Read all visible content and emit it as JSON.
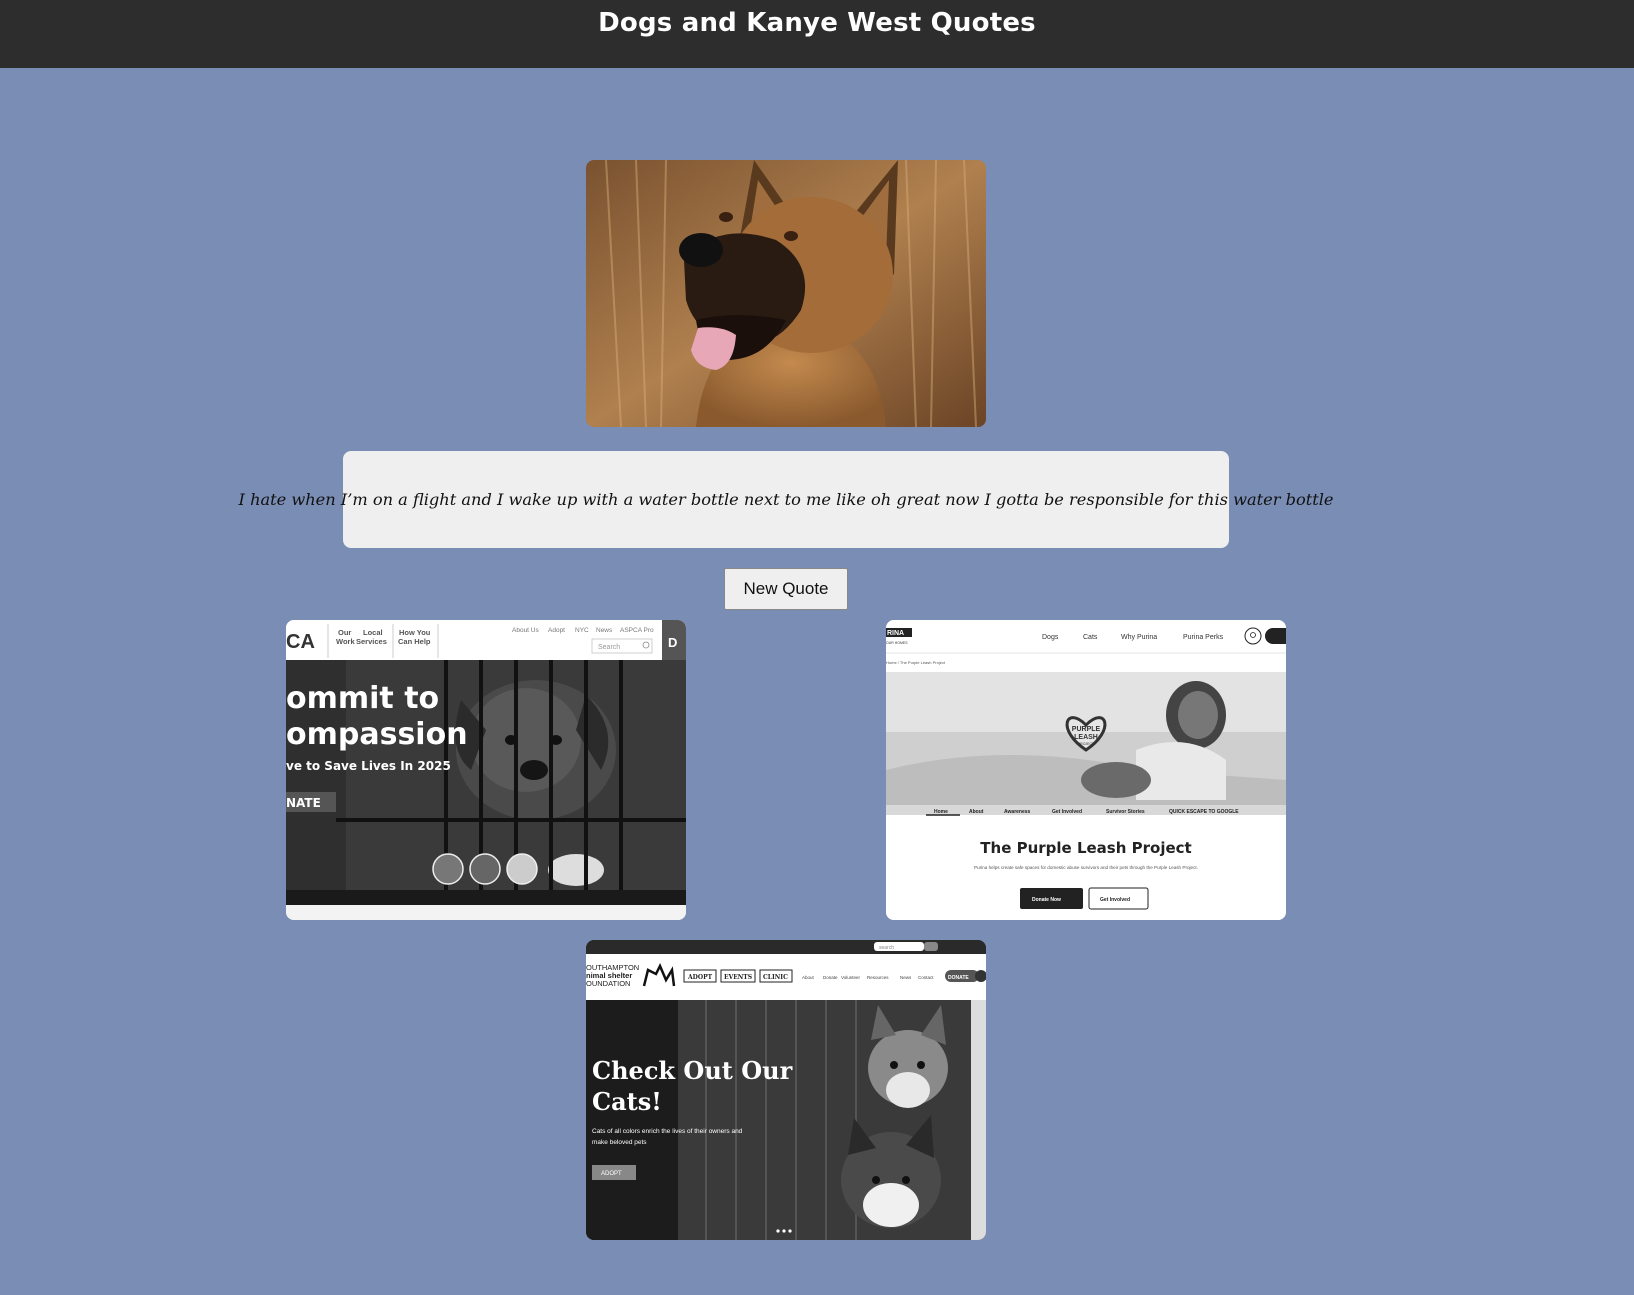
{
  "header": {
    "title": "Dogs and Kanye West Quotes"
  },
  "dog_image": {
    "alt": "German Shepherd dog in a field"
  },
  "quote": {
    "text": "I hate when I’m on a flight and I wake up with a water bottle next to me like oh great now I gotta be responsible for this water bottle"
  },
  "button": {
    "label": "New Quote"
  },
  "cards": [
    {
      "name": "ASPCA",
      "logo": "CA",
      "nav": [
        "Our",
        "Work",
        "Local",
        "Services",
        "How You",
        "Can Help"
      ],
      "utility": [
        "About Us",
        "Adopt",
        "NYC",
        "News",
        "ASPCA Pro"
      ],
      "search_placeholder": "Search",
      "side_tab": "D",
      "headline_1": "ommit to",
      "headline_2": "ompassion",
      "subline": "ve to Save Lives In 2025",
      "cta": "NATE"
    },
    {
      "name": "Purina Purple Leash Project",
      "logo": "RINA",
      "logo_sub": "OUR HOMES",
      "nav": [
        "Dogs",
        "Cats",
        "Why Purina",
        "Purina Perks"
      ],
      "breadcrumb": "Home / The Purple Leash Project",
      "badge": [
        "PURPLE",
        "LEASH",
        "PROJECT"
      ],
      "tabs": [
        "Home",
        "About",
        "Awareness",
        "Get Involved",
        "Survivor Stories",
        "QUICK ESCAPE TO GOOGLE"
      ],
      "title": "The Purple Leash Project",
      "description": "Purina helps create safe spaces for domestic abuse survivors and their pets through the Purple Leash Project.",
      "primary_button": "Donate Now",
      "secondary_button": "Get Involved"
    },
    {
      "name": "Southampton Animal Shelter Foundation",
      "search_placeholder": "search",
      "logo_lines": [
        "OUTHAMPTON",
        "nimal shelter",
        "OUNDATION"
      ],
      "nav_boxes": [
        "ADOPT",
        "EVENTS",
        "CLINIC"
      ],
      "nav_links": [
        "About",
        "Donate",
        "Volunteer",
        "Resources",
        "News",
        "Contact"
      ],
      "donate": "DONATE",
      "headline_1": "Check Out Our",
      "headline_2": "Cats!",
      "body_1": "Cats of all colors enrich the lives of their owners and",
      "body_2": "make beloved pets",
      "cta": "ADOPT"
    }
  ]
}
